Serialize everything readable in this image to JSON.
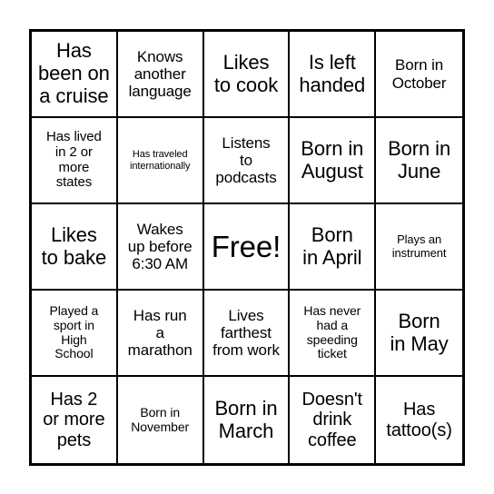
{
  "card": {
    "type": "bingo-card",
    "columns": 5,
    "rows": 5,
    "border_color": "#000000",
    "background_color": "#ffffff",
    "text_color": "#000000",
    "free_space_index": 12,
    "cells": [
      {
        "text": "Has\nbeen on\na cruise",
        "size": "xl"
      },
      {
        "text": "Knows\nanother\nlanguage",
        "size": "m2"
      },
      {
        "text": "Likes\nto cook",
        "size": "xl"
      },
      {
        "text": "Is left\nhanded",
        "size": "xl"
      },
      {
        "text": "Born in\nOctober",
        "size": "m2"
      },
      {
        "text": "Has lived\nin 2 or\nmore\nstates",
        "size": "m"
      },
      {
        "text": "Has traveled\ninternationally",
        "size": "xs"
      },
      {
        "text": "Listens\nto\npodcasts",
        "size": "m2"
      },
      {
        "text": "Born in\nAugust",
        "size": "xl"
      },
      {
        "text": "Born in\nJune",
        "size": "xl"
      },
      {
        "text": "Likes\nto bake",
        "size": "xl"
      },
      {
        "text": "Wakes\nup before\n6:30 AM",
        "size": "m2"
      },
      {
        "text": "Free!",
        "size": "xxl"
      },
      {
        "text": "Born\nin April",
        "size": "xl"
      },
      {
        "text": "Plays an\ninstrument",
        "size": "s"
      },
      {
        "text": "Played a\nsport in\nHigh\nSchool",
        "size": "s2"
      },
      {
        "text": "Has run\na\nmarathon",
        "size": "m2"
      },
      {
        "text": "Lives\nfarthest\nfrom work",
        "size": "m2"
      },
      {
        "text": "Has never\nhad a\nspeeding\nticket",
        "size": "s2"
      },
      {
        "text": "Born\nin May",
        "size": "xl"
      },
      {
        "text": "Has 2\nor more\npets",
        "size": "l"
      },
      {
        "text": "Born in\nNovember",
        "size": "s2"
      },
      {
        "text": "Born in\nMarch",
        "size": "xl"
      },
      {
        "text": "Doesn't\ndrink\ncoffee",
        "size": "l"
      },
      {
        "text": "Has\ntattoo(s)",
        "size": "l"
      }
    ]
  }
}
